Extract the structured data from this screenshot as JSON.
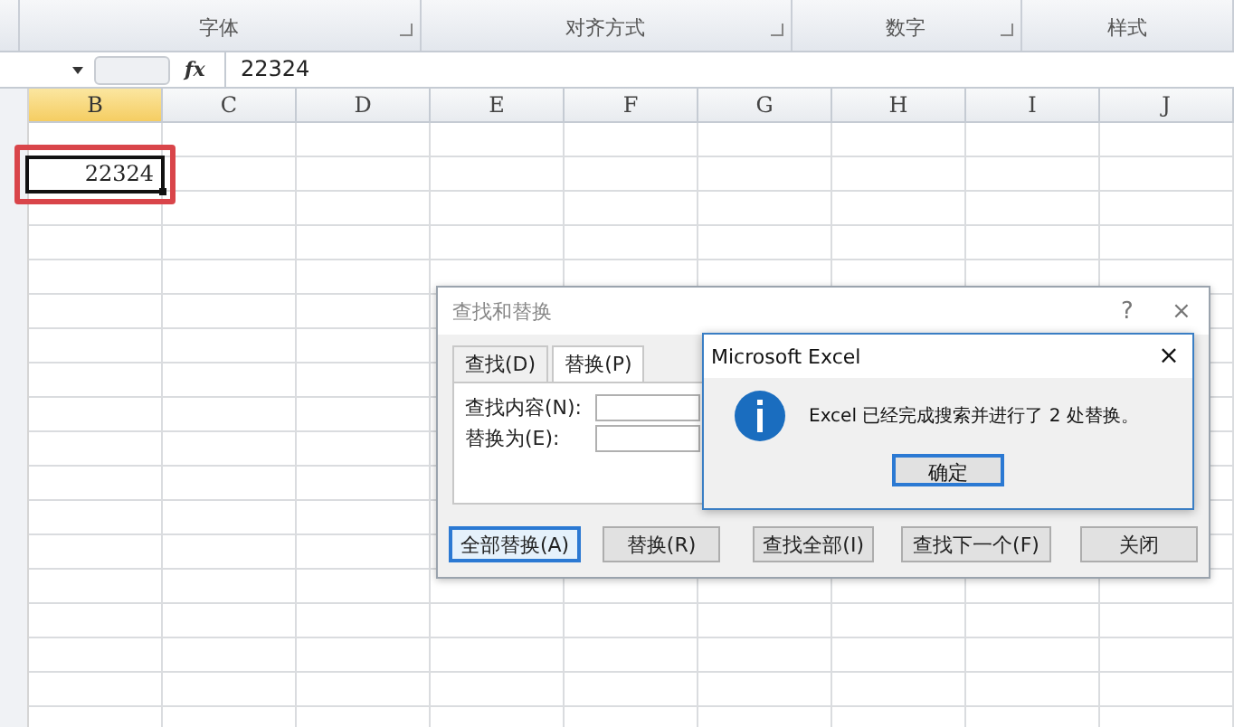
{
  "ribbon": {
    "groups": [
      {
        "label": "字体"
      },
      {
        "label": "对齐方式"
      },
      {
        "label": "数字"
      },
      {
        "label": "样式"
      }
    ]
  },
  "formula_bar": {
    "fx": "fx",
    "value": "22324"
  },
  "columns": [
    {
      "label": "B",
      "selected": true
    },
    {
      "label": "C",
      "selected": false
    },
    {
      "label": "D",
      "selected": false
    },
    {
      "label": "E",
      "selected": false
    },
    {
      "label": "F",
      "selected": false
    },
    {
      "label": "G",
      "selected": false
    },
    {
      "label": "H",
      "selected": false
    },
    {
      "label": "I",
      "selected": false
    },
    {
      "label": "J",
      "selected": false
    }
  ],
  "active_cell": {
    "value": "22324",
    "highlighted": true
  },
  "find_dialog": {
    "title": "查找和替换",
    "help": "?",
    "close": "×",
    "tabs": [
      {
        "label": "查找(D)",
        "selected": false
      },
      {
        "label": "替换(P)",
        "selected": true
      }
    ],
    "fields": [
      {
        "label": "查找内容(N):"
      },
      {
        "label": "替换为(E):"
      }
    ],
    "buttons": [
      {
        "label": "全部替换(A)",
        "selected": true
      },
      {
        "label": "替换(R)",
        "selected": false
      },
      {
        "label": "查找全部(I)",
        "selected": false
      },
      {
        "label": "查找下一个(F)",
        "selected": false
      },
      {
        "label": "关闭",
        "selected": false
      }
    ]
  },
  "message_box": {
    "title": "Microsoft Excel",
    "close": "×",
    "message": "Excel 已经完成搜索并进行了 2 处替换。",
    "button": "确定"
  }
}
